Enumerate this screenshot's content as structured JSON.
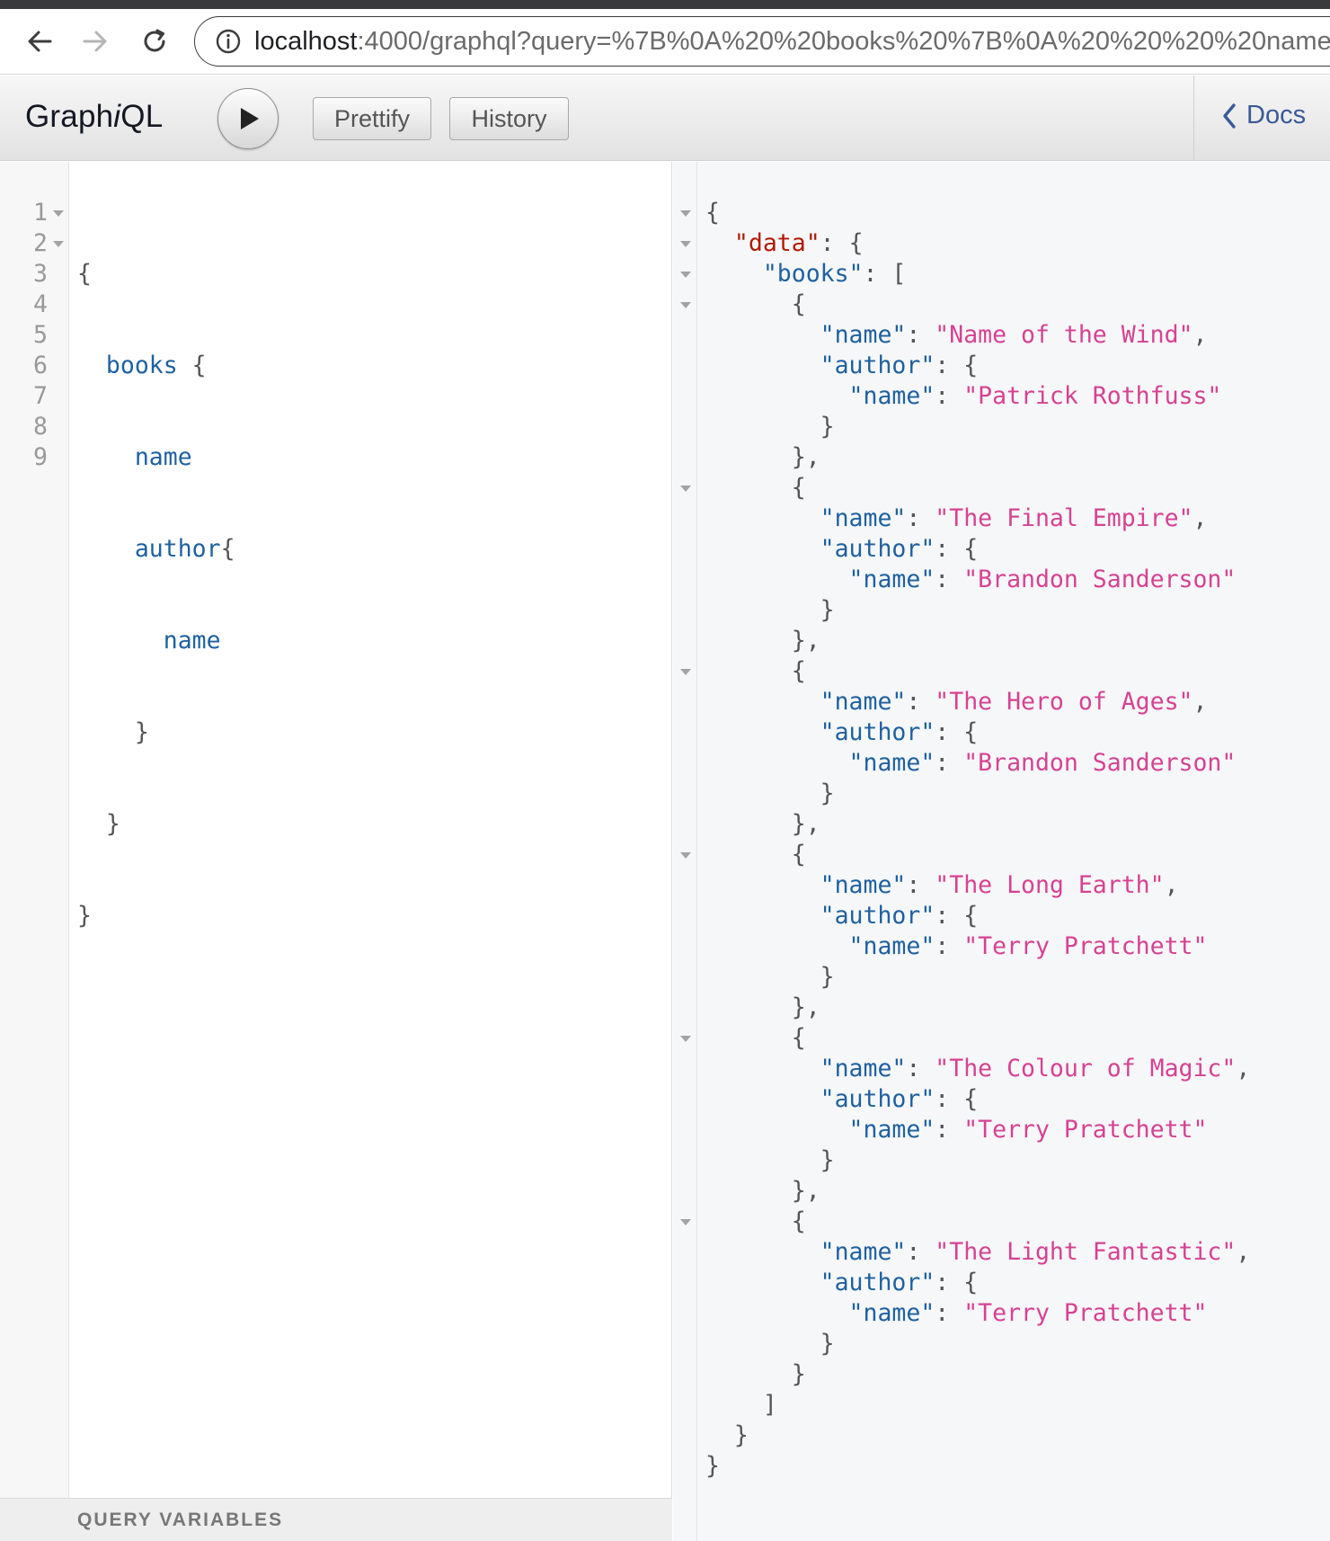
{
  "browser": {
    "url_host": "localhost",
    "url_rest": ":4000/graphql?query=%7B%0A%20%20books%20%7B%0A%20%20%20%20name%"
  },
  "toolbar": {
    "title_prefix": "Graph",
    "title_italic": "i",
    "title_suffix": "QL",
    "prettify_label": "Prettify",
    "history_label": "History",
    "docs_label": "Docs"
  },
  "query_editor": {
    "line_numbers": [
      "1",
      "2",
      "3",
      "4",
      "5",
      "6",
      "7",
      "8",
      "9"
    ],
    "lines": [
      {
        "indent": "",
        "field": "",
        "punct": "{"
      },
      {
        "indent": "  ",
        "field": "books",
        "punct": " {"
      },
      {
        "indent": "    ",
        "field": "name",
        "punct": ""
      },
      {
        "indent": "    ",
        "field": "author",
        "punct": "{"
      },
      {
        "indent": "      ",
        "field": "name",
        "punct": ""
      },
      {
        "indent": "    ",
        "field": "",
        "punct": "}"
      },
      {
        "indent": "  ",
        "field": "",
        "punct": "}"
      },
      {
        "indent": "",
        "field": "",
        "punct": "}"
      },
      {
        "indent": "",
        "field": "",
        "punct": ""
      }
    ],
    "query_variables_label": "QUERY VARIABLES"
  },
  "result": {
    "books": [
      {
        "name": "Name of the Wind",
        "author": "Patrick Rothfuss"
      },
      {
        "name": "The Final Empire",
        "author": "Brandon Sanderson"
      },
      {
        "name": "The Hero of Ages",
        "author": "Brandon Sanderson"
      },
      {
        "name": "The Long Earth",
        "author": "Terry Pratchett"
      },
      {
        "name": "The Colour of Magic",
        "author": "Terry Pratchett"
      },
      {
        "name": "The Light Fantastic",
        "author": "Terry Pratchett"
      }
    ]
  },
  "icons": {
    "back": "arrow-left-icon",
    "forward": "arrow-right-icon",
    "reload": "reload-icon",
    "info": "info-icon",
    "run": "play-icon",
    "docs": "chevron-left-icon"
  },
  "colors": {
    "field": "#1f61a0",
    "data_key": "#b11a04",
    "string": "#d64292",
    "docs_link": "#3b5998"
  }
}
